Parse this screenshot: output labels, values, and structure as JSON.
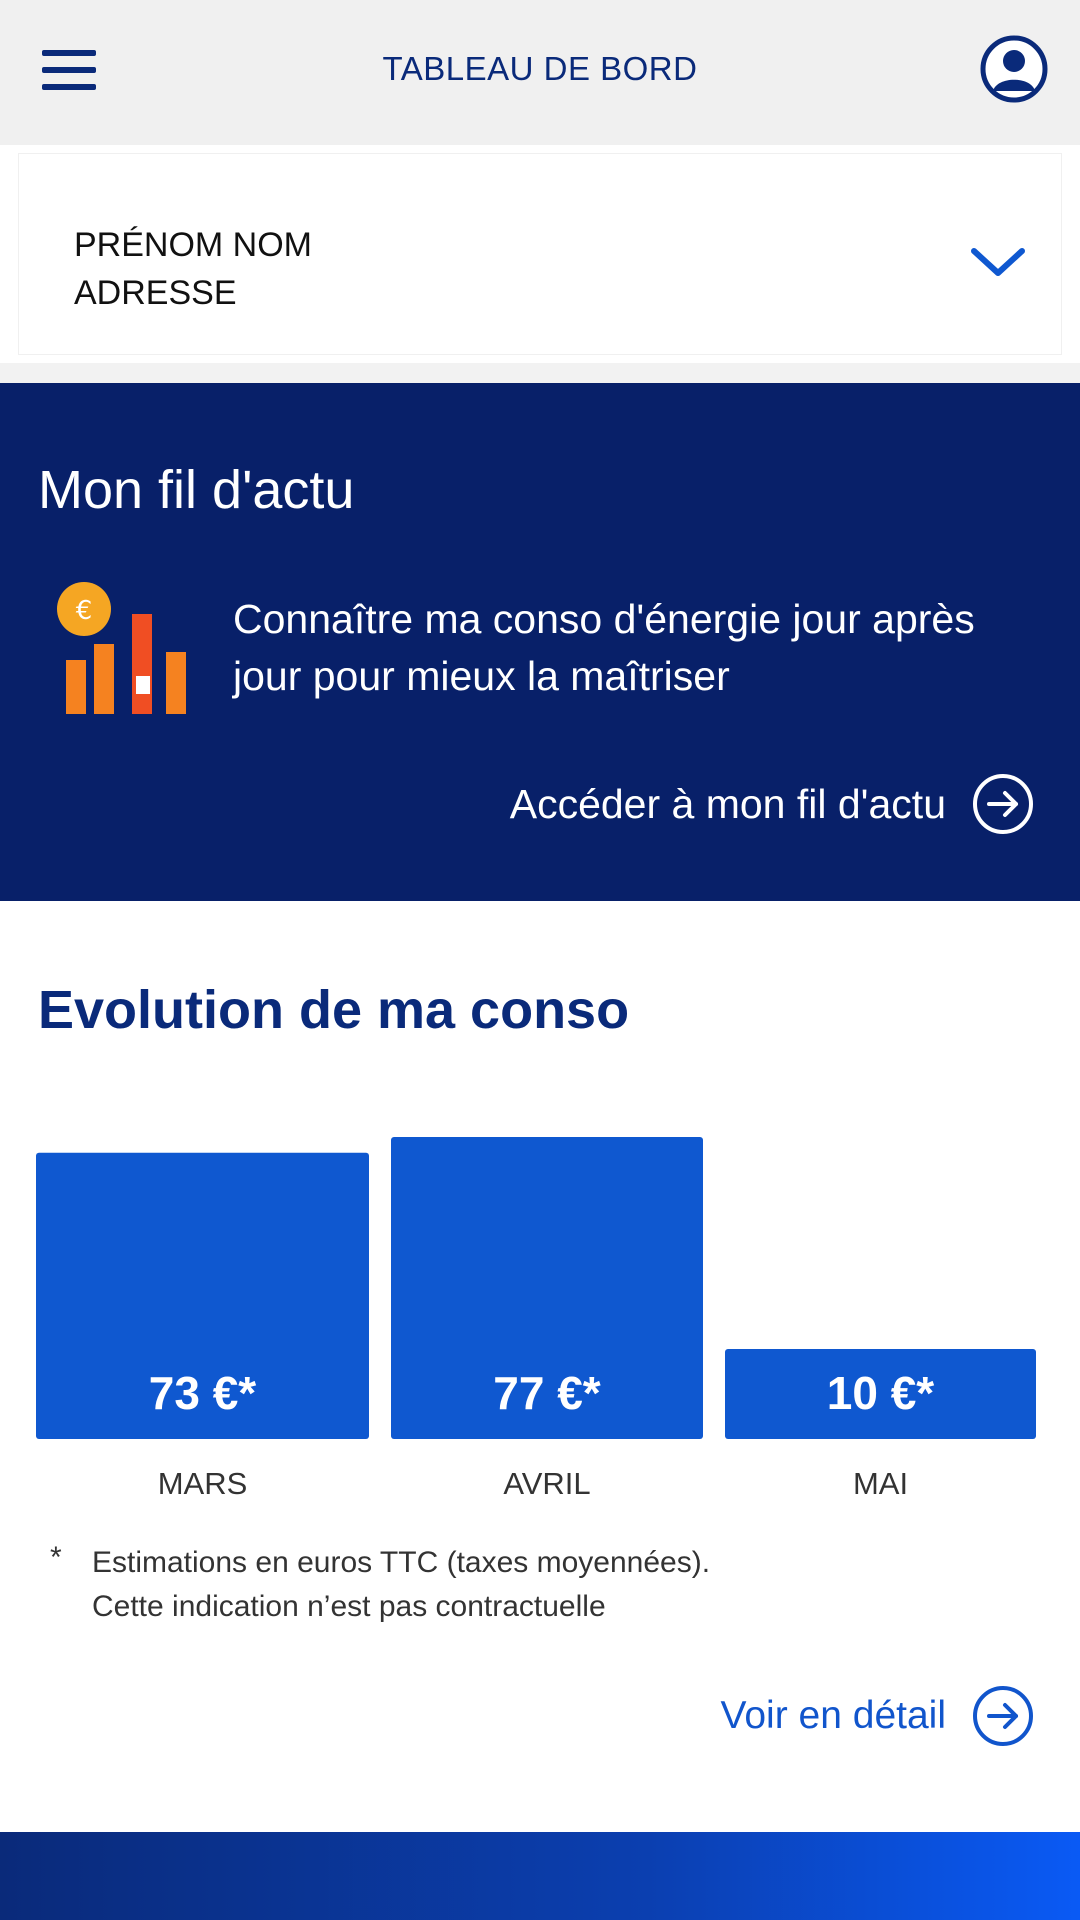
{
  "header": {
    "title": "TABLEAU DE BORD",
    "menu_icon": "hamburger-menu-icon",
    "profile_icon": "user-profile-icon"
  },
  "account": {
    "name": "PRÉNOM NOM",
    "address": "ADRESSE",
    "expand_icon": "chevron-down-icon"
  },
  "feed": {
    "title": "Mon fil d'actu",
    "text": "Connaître ma conso d'énergie jour après jour pour mieux la maîtriser",
    "illustration_icon": "energy-bars-euro-icon",
    "illustration_coin_symbol": "€",
    "link_label": "Accéder à mon fil d'actu",
    "link_icon": "arrow-right-circle-icon"
  },
  "conso": {
    "title": "Evolution de ma conso",
    "footnote_star": "*",
    "footnote_line1": "Estimations en euros TTC (taxes moyennées).",
    "footnote_line2": "Cette indication n’est pas contractuelle",
    "detail_label": "Voir en détail",
    "detail_icon": "arrow-right-circle-icon"
  },
  "colors": {
    "header_bg": "#f0f0f0",
    "navy": "#082069",
    "title_blue": "#0a2a7a",
    "bar_blue": "#0f58d0",
    "link_blue": "#1155cc",
    "orange": "#f58220"
  },
  "chart_data": {
    "type": "bar",
    "categories": [
      "MARS",
      "AVRIL",
      "MAI"
    ],
    "values": [
      73,
      77,
      10
    ],
    "value_labels": [
      "73 €*",
      "77 €*",
      "10 €*"
    ],
    "unit": "€",
    "title": "Evolution de ma conso",
    "grid": false,
    "legend": "none"
  }
}
